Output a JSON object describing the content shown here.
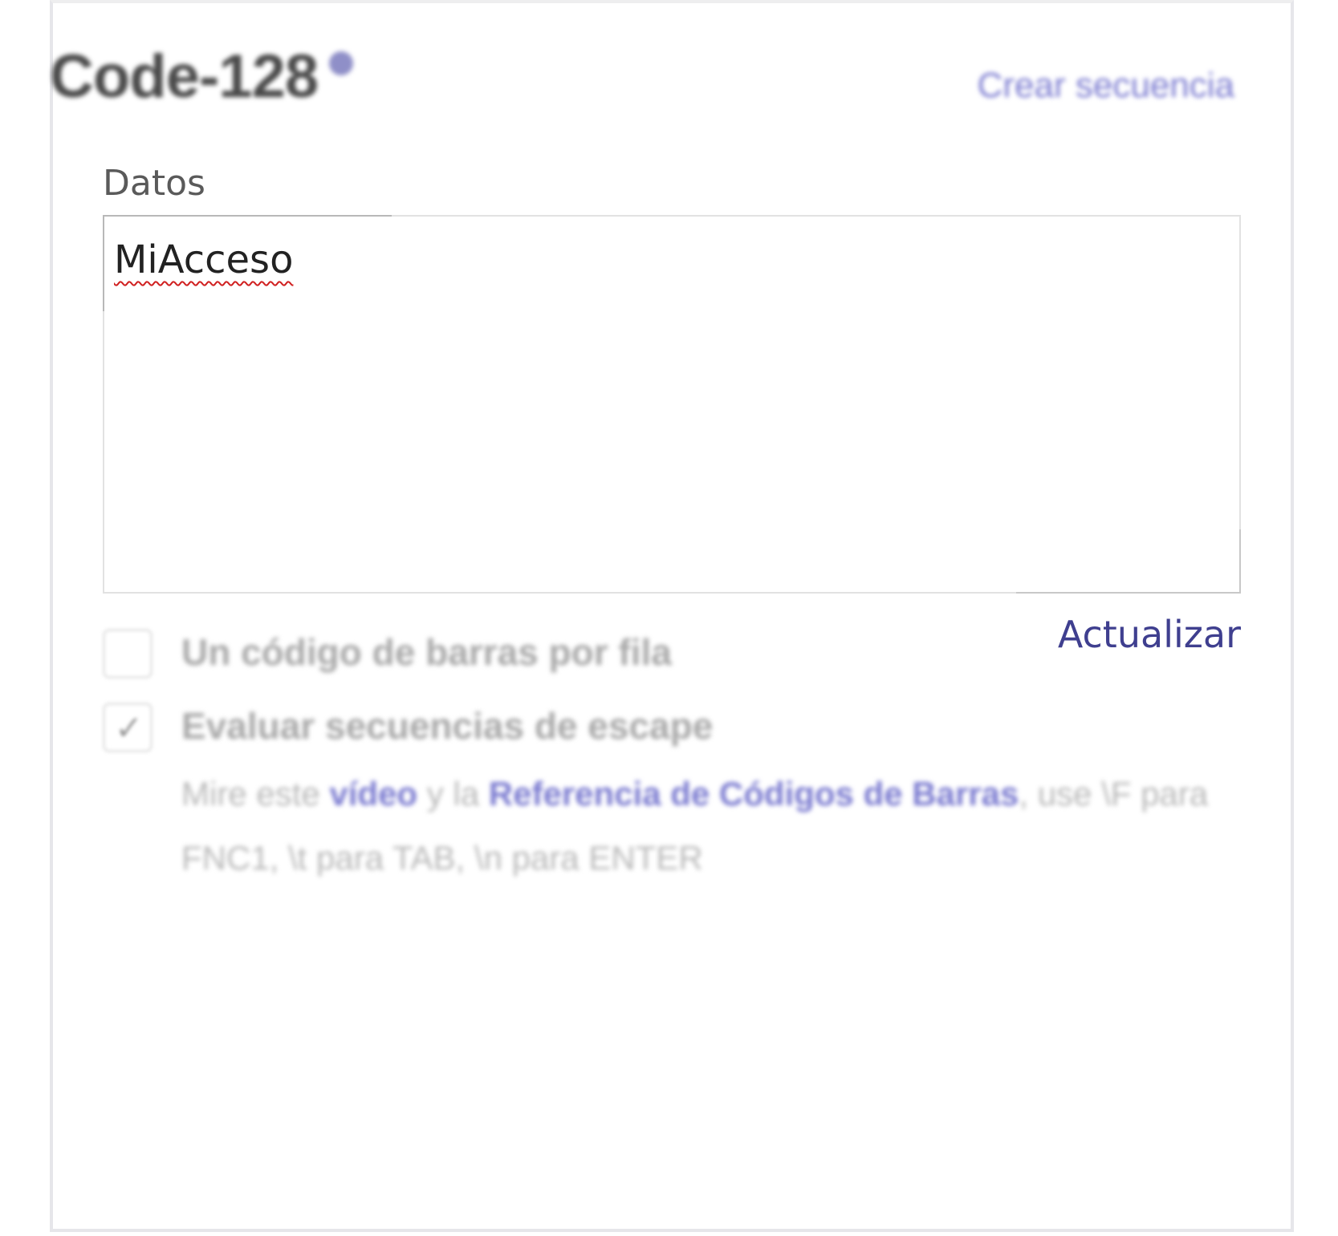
{
  "header": {
    "title": "Code-128",
    "info_icon": "info-icon",
    "create_sequence_label": "Crear secuencia"
  },
  "data_field": {
    "label": "Datos",
    "value": "MiAcceso"
  },
  "update_label": "Actualizar",
  "options": {
    "one_per_row": {
      "label": "Un código de barras por fila",
      "checked": false
    },
    "escape_sequences": {
      "label": "Evaluar secuencias de escape",
      "checked": true,
      "check_glyph": "✓"
    }
  },
  "help": {
    "prefix": "Mire este",
    "video_link": "vídeo",
    "middle": "y la",
    "reference_link": "Referencia de Códigos de Barras",
    "suffix": ", use \\F para FNC1, \\t para TAB, \\n para ENTER"
  },
  "colors": {
    "link": "#3f3f8f",
    "link_light": "#7a7ad0",
    "title": "#4a4a4a",
    "spell_underline": "#d02020"
  }
}
